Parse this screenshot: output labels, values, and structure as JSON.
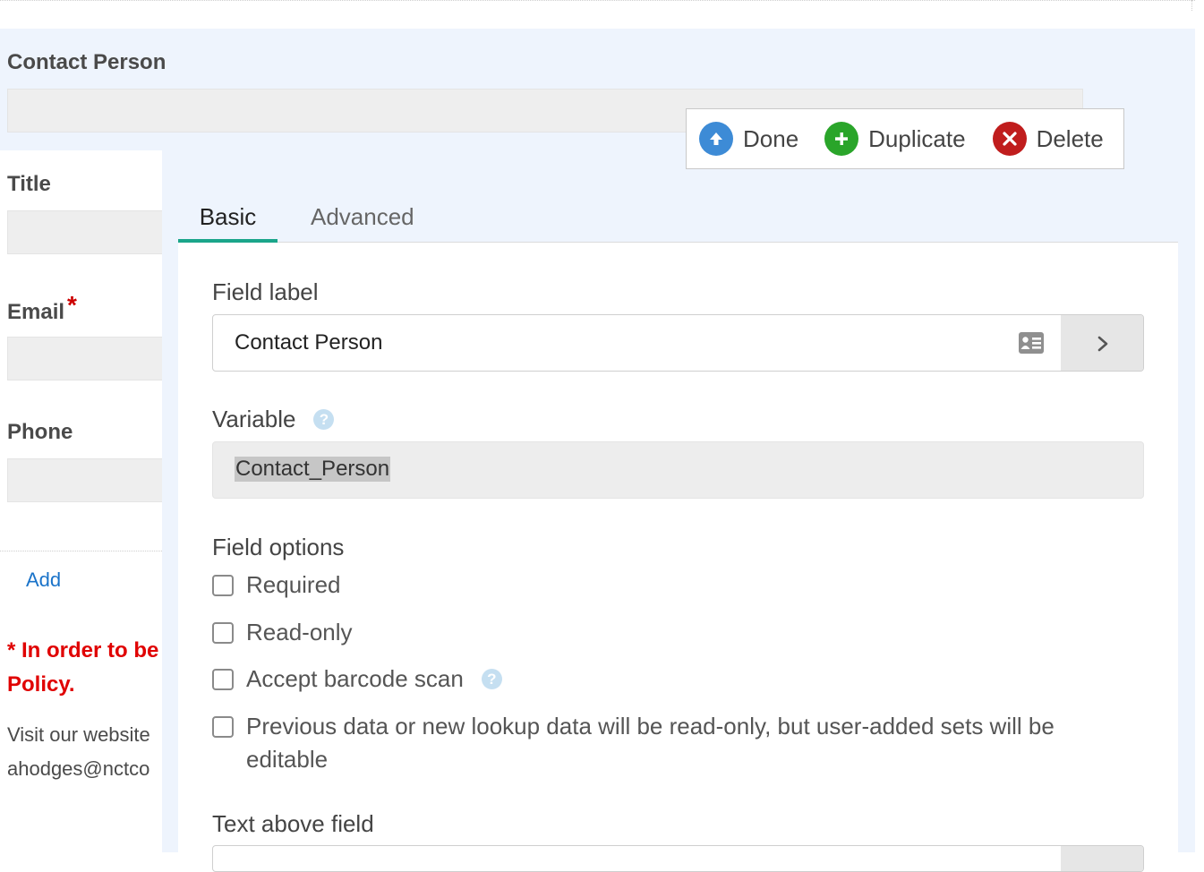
{
  "field_preview": {
    "label": "Contact Person"
  },
  "left_form": {
    "title_label": "Title",
    "email_label": "Email",
    "required_mark": "*",
    "phone_label": "Phone",
    "add_link": "Add",
    "notice_line1": "* In order to be",
    "notice_line2": "Policy.",
    "visit_line1": "Visit our website",
    "visit_line2": "ahodges@nctco"
  },
  "toolbar": {
    "done_label": "Done",
    "duplicate_label": "Duplicate",
    "delete_label": "Delete",
    "colors": {
      "done": "#3d8bd6",
      "duplicate": "#2aa52a",
      "delete": "#c01d1d"
    }
  },
  "tabs": [
    {
      "label": "Basic",
      "active": true
    },
    {
      "label": "Advanced",
      "active": false
    }
  ],
  "settings": {
    "field_label": {
      "heading": "Field label",
      "value": "Contact Person",
      "icon": "contact-card-icon"
    },
    "variable": {
      "heading": "Variable",
      "value": "Contact_Person",
      "help_icon": "help-icon"
    },
    "field_options": {
      "heading": "Field options",
      "options": [
        {
          "label": "Required",
          "checked": false
        },
        {
          "label": "Read-only",
          "checked": false
        },
        {
          "label": "Accept barcode scan",
          "checked": false
        },
        {
          "label": "Previous data or new lookup data will be read-only, but user-added sets will be editable",
          "checked": false
        }
      ]
    },
    "text_above_field": {
      "heading": "Text above field"
    }
  },
  "accent_color": "#1aa58a"
}
